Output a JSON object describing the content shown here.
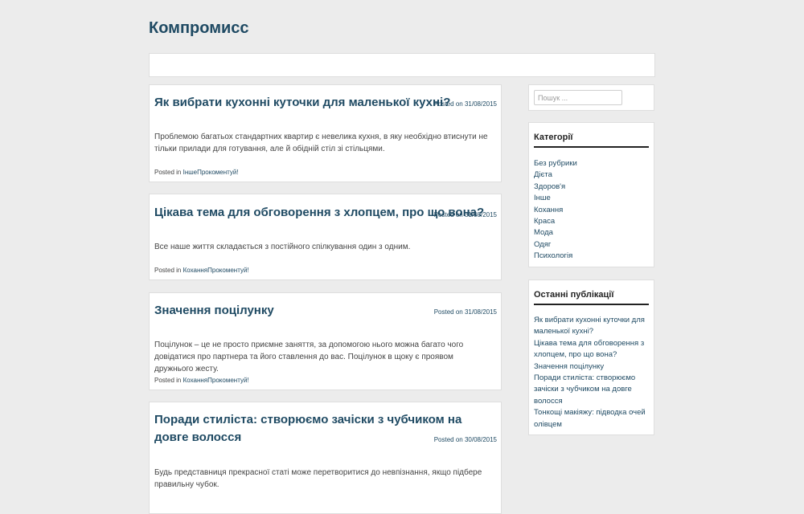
{
  "site": {
    "title": "Компромисс"
  },
  "posts": [
    {
      "title": "Як вибрати кухонні куточки для маленької кухні?",
      "posted_label": "Posted on",
      "date": "31/08/2015",
      "excerpt": "Проблемою багатьох стандартних квартир є невелика кухня, в яку необхідно втиснути не тільки прилади для готування, але й обідній стіл зі стільцями.",
      "posted_in": "Posted in",
      "category": "Інше",
      "comment": "Прокоментуй!"
    },
    {
      "title": "Цікава тема для обговорення з хлопцем, про що вона?",
      "posted_label": "Posted on",
      "date": "31/08/2015",
      "excerpt": "Все наше життя складається з постійного спілкування один з одним.",
      "posted_in": "Posted in",
      "category": "Кохання",
      "comment": "Прокоментуй!"
    },
    {
      "title": "Значення поцілунку",
      "posted_label": "Posted on",
      "date": "31/08/2015",
      "excerpt": "Поцілунок – це не просто приємне заняття, за допомогою нього можна багато чого довідатися про партнера та його ставлення до вас. Поцілунок в щоку є проявом дружнього жесту.",
      "posted_in": "Posted in",
      "category": "Кохання",
      "comment": "Прокоментуй!"
    },
    {
      "title": "Поради стиліста: створюємо зачіски з чубчиком на довге волосся",
      "posted_label": "Posted on",
      "date": "30/08/2015",
      "excerpt": "Будь представниця прекрасної статі може перетворитися до невпізнання, якщо підбере правильну чубок."
    }
  ],
  "sidebar": {
    "search": {
      "placeholder": "Пошук ..."
    },
    "categories": {
      "title": "Категорії",
      "items": [
        "Без рубрики",
        "Дієта",
        "Здоров'я",
        "Інше",
        "Кохання",
        "Краса",
        "Мода",
        "Одяг",
        "Психологія"
      ]
    },
    "recent": {
      "title": "Останні публікації",
      "items": [
        "Як вибрати кухонні куточки для маленької кухні?",
        "Цікава тема для обговорення з хлопцем, про що вона?",
        "Значення поцілунку",
        "Поради стиліста: створюємо зачіски з чубчиком на довге волосся",
        "Тонкощі макіяжу: підводка очей олівцем"
      ]
    }
  }
}
